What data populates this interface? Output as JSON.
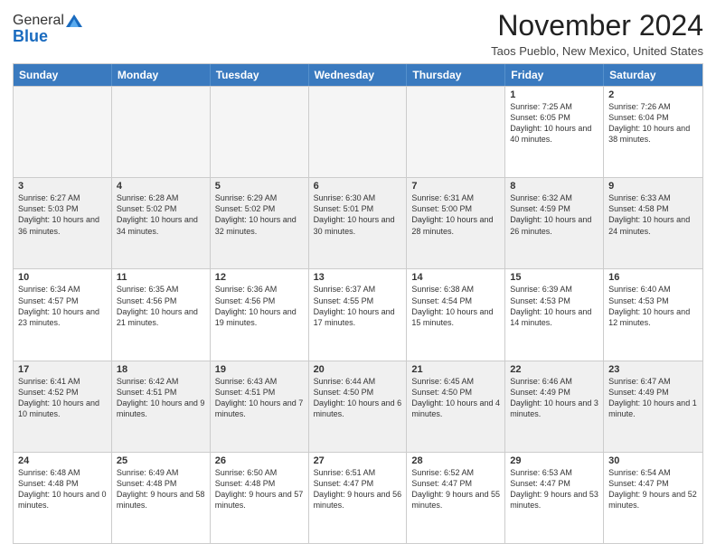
{
  "header": {
    "logo_general": "General",
    "logo_blue": "Blue",
    "month_title": "November 2024",
    "location": "Taos Pueblo, New Mexico, United States"
  },
  "days_of_week": [
    "Sunday",
    "Monday",
    "Tuesday",
    "Wednesday",
    "Thursday",
    "Friday",
    "Saturday"
  ],
  "rows": [
    [
      {
        "day": "",
        "info": "",
        "empty": true
      },
      {
        "day": "",
        "info": "",
        "empty": true
      },
      {
        "day": "",
        "info": "",
        "empty": true
      },
      {
        "day": "",
        "info": "",
        "empty": true
      },
      {
        "day": "",
        "info": "",
        "empty": true
      },
      {
        "day": "1",
        "info": "Sunrise: 7:25 AM\nSunset: 6:05 PM\nDaylight: 10 hours and 40 minutes."
      },
      {
        "day": "2",
        "info": "Sunrise: 7:26 AM\nSunset: 6:04 PM\nDaylight: 10 hours and 38 minutes."
      }
    ],
    [
      {
        "day": "3",
        "info": "Sunrise: 6:27 AM\nSunset: 5:03 PM\nDaylight: 10 hours and 36 minutes.",
        "shaded": true
      },
      {
        "day": "4",
        "info": "Sunrise: 6:28 AM\nSunset: 5:02 PM\nDaylight: 10 hours and 34 minutes.",
        "shaded": true
      },
      {
        "day": "5",
        "info": "Sunrise: 6:29 AM\nSunset: 5:02 PM\nDaylight: 10 hours and 32 minutes.",
        "shaded": true
      },
      {
        "day": "6",
        "info": "Sunrise: 6:30 AM\nSunset: 5:01 PM\nDaylight: 10 hours and 30 minutes.",
        "shaded": true
      },
      {
        "day": "7",
        "info": "Sunrise: 6:31 AM\nSunset: 5:00 PM\nDaylight: 10 hours and 28 minutes.",
        "shaded": true
      },
      {
        "day": "8",
        "info": "Sunrise: 6:32 AM\nSunset: 4:59 PM\nDaylight: 10 hours and 26 minutes.",
        "shaded": true
      },
      {
        "day": "9",
        "info": "Sunrise: 6:33 AM\nSunset: 4:58 PM\nDaylight: 10 hours and 24 minutes.",
        "shaded": true
      }
    ],
    [
      {
        "day": "10",
        "info": "Sunrise: 6:34 AM\nSunset: 4:57 PM\nDaylight: 10 hours and 23 minutes."
      },
      {
        "day": "11",
        "info": "Sunrise: 6:35 AM\nSunset: 4:56 PM\nDaylight: 10 hours and 21 minutes."
      },
      {
        "day": "12",
        "info": "Sunrise: 6:36 AM\nSunset: 4:56 PM\nDaylight: 10 hours and 19 minutes."
      },
      {
        "day": "13",
        "info": "Sunrise: 6:37 AM\nSunset: 4:55 PM\nDaylight: 10 hours and 17 minutes."
      },
      {
        "day": "14",
        "info": "Sunrise: 6:38 AM\nSunset: 4:54 PM\nDaylight: 10 hours and 15 minutes."
      },
      {
        "day": "15",
        "info": "Sunrise: 6:39 AM\nSunset: 4:53 PM\nDaylight: 10 hours and 14 minutes."
      },
      {
        "day": "16",
        "info": "Sunrise: 6:40 AM\nSunset: 4:53 PM\nDaylight: 10 hours and 12 minutes."
      }
    ],
    [
      {
        "day": "17",
        "info": "Sunrise: 6:41 AM\nSunset: 4:52 PM\nDaylight: 10 hours and 10 minutes.",
        "shaded": true
      },
      {
        "day": "18",
        "info": "Sunrise: 6:42 AM\nSunset: 4:51 PM\nDaylight: 10 hours and 9 minutes.",
        "shaded": true
      },
      {
        "day": "19",
        "info": "Sunrise: 6:43 AM\nSunset: 4:51 PM\nDaylight: 10 hours and 7 minutes.",
        "shaded": true
      },
      {
        "day": "20",
        "info": "Sunrise: 6:44 AM\nSunset: 4:50 PM\nDaylight: 10 hours and 6 minutes.",
        "shaded": true
      },
      {
        "day": "21",
        "info": "Sunrise: 6:45 AM\nSunset: 4:50 PM\nDaylight: 10 hours and 4 minutes.",
        "shaded": true
      },
      {
        "day": "22",
        "info": "Sunrise: 6:46 AM\nSunset: 4:49 PM\nDaylight: 10 hours and 3 minutes.",
        "shaded": true
      },
      {
        "day": "23",
        "info": "Sunrise: 6:47 AM\nSunset: 4:49 PM\nDaylight: 10 hours and 1 minute.",
        "shaded": true
      }
    ],
    [
      {
        "day": "24",
        "info": "Sunrise: 6:48 AM\nSunset: 4:48 PM\nDaylight: 10 hours and 0 minutes."
      },
      {
        "day": "25",
        "info": "Sunrise: 6:49 AM\nSunset: 4:48 PM\nDaylight: 9 hours and 58 minutes."
      },
      {
        "day": "26",
        "info": "Sunrise: 6:50 AM\nSunset: 4:48 PM\nDaylight: 9 hours and 57 minutes."
      },
      {
        "day": "27",
        "info": "Sunrise: 6:51 AM\nSunset: 4:47 PM\nDaylight: 9 hours and 56 minutes."
      },
      {
        "day": "28",
        "info": "Sunrise: 6:52 AM\nSunset: 4:47 PM\nDaylight: 9 hours and 55 minutes."
      },
      {
        "day": "29",
        "info": "Sunrise: 6:53 AM\nSunset: 4:47 PM\nDaylight: 9 hours and 53 minutes."
      },
      {
        "day": "30",
        "info": "Sunrise: 6:54 AM\nSunset: 4:47 PM\nDaylight: 9 hours and 52 minutes."
      }
    ]
  ]
}
